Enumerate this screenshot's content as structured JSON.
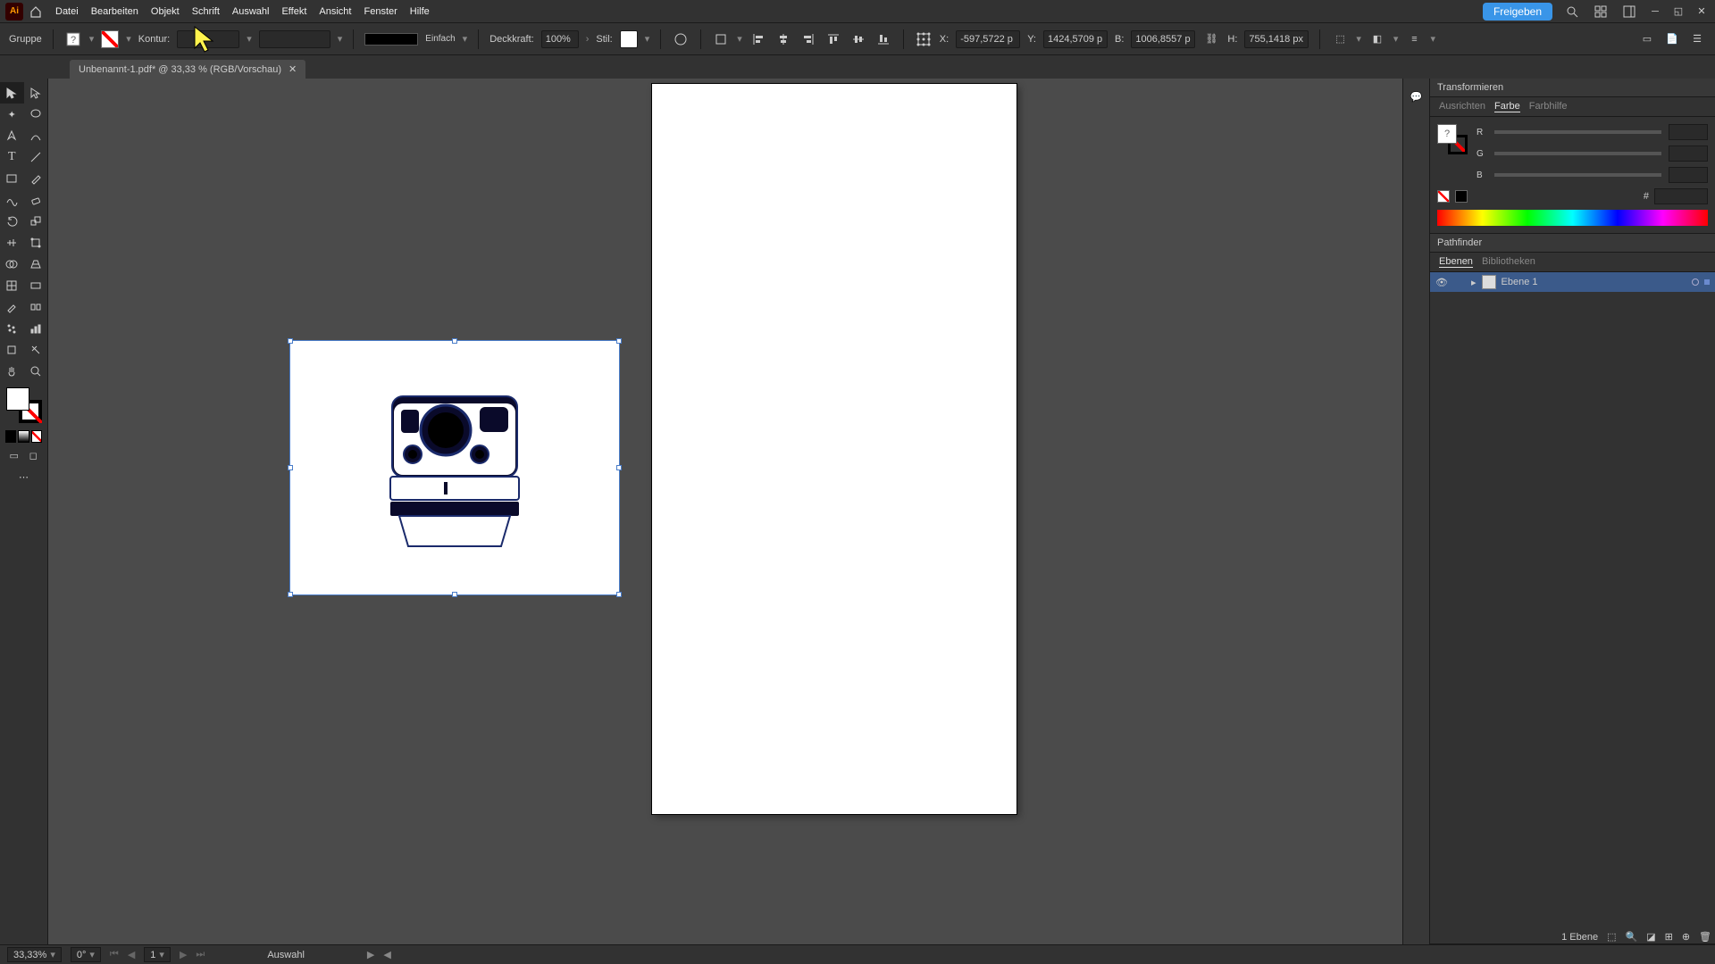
{
  "menubar": {
    "items": [
      "Datei",
      "Bearbeiten",
      "Objekt",
      "Schrift",
      "Auswahl",
      "Effekt",
      "Ansicht",
      "Fenster",
      "Hilfe"
    ],
    "share": "Freigeben"
  },
  "controlbar": {
    "selection_type": "Gruppe",
    "stroke_label": "Kontur:",
    "brush_preset": "Einfach",
    "opacity_label": "Deckkraft:",
    "opacity_value": "100%",
    "style_label": "Stil:",
    "x_label": "X:",
    "x_value": "-597,5722 p",
    "y_label": "Y:",
    "y_value": "1424,5709 p",
    "w_label": "B:",
    "w_value": "1006,8557 p",
    "h_label": "H:",
    "h_value": "755,1418 px"
  },
  "document": {
    "tab_title": "Unbenannt-1.pdf* @ 33,33 % (RGB/Vorschau)"
  },
  "panels": {
    "transform": "Transformieren",
    "align": "Ausrichten",
    "color": "Farbe",
    "color_guide": "Farbhilfe",
    "pathfinder": "Pathfinder",
    "layers": "Ebenen",
    "libraries": "Bibliotheken",
    "rgb": {
      "r": "R",
      "g": "G",
      "b": "B",
      "hash": "#"
    }
  },
  "layers": {
    "item1": "Ebene 1",
    "count": "1 Ebene"
  },
  "statusbar": {
    "zoom": "33,33%",
    "rotation": "0°",
    "artboard_no": "1",
    "tool": "Auswahl"
  }
}
